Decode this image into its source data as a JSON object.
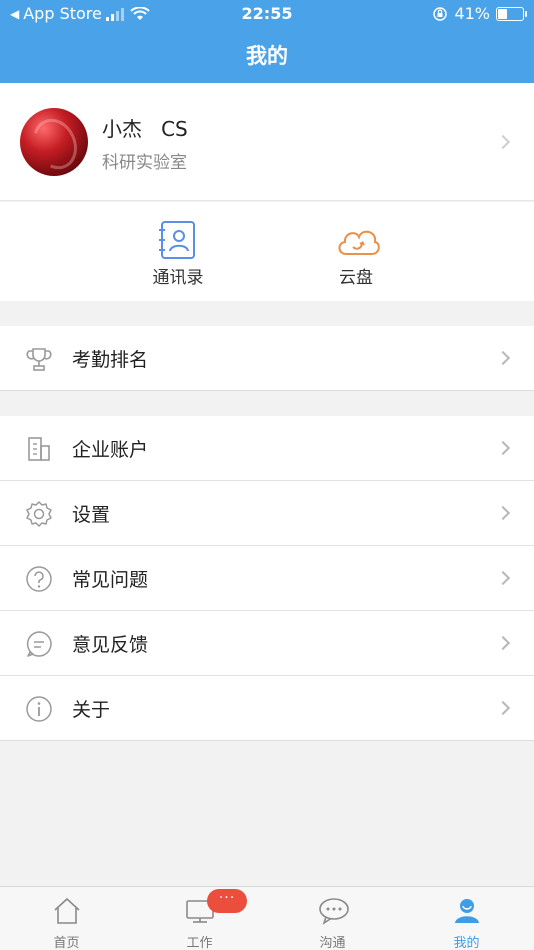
{
  "status_bar": {
    "back_app": "App Store",
    "time": "22:55",
    "battery": "41%",
    "battery_level": 0.41
  },
  "header": {
    "title": "我的"
  },
  "profile": {
    "name": "小杰   CS",
    "org": "科研实验室"
  },
  "quick_actions": [
    {
      "label": "通讯录",
      "icon": "contacts-icon",
      "color": "#5b8ee6"
    },
    {
      "label": "云盘",
      "icon": "cloud-icon",
      "color": "#e8914b"
    }
  ],
  "menu_group1": [
    {
      "label": "考勤排名",
      "icon": "trophy-icon"
    }
  ],
  "menu_group2": [
    {
      "label": "企业账户",
      "icon": "building-icon"
    },
    {
      "label": "设置",
      "icon": "gear-icon"
    },
    {
      "label": "常见问题",
      "icon": "question-icon"
    },
    {
      "label": "意见反馈",
      "icon": "feedback-icon"
    },
    {
      "label": "关于",
      "icon": "info-icon"
    }
  ],
  "tabbar": {
    "tabs": [
      {
        "label": "首页",
        "icon": "home-icon"
      },
      {
        "label": "工作",
        "icon": "monitor-icon"
      },
      {
        "label": "沟通",
        "icon": "chat-icon"
      },
      {
        "label": "我的",
        "icon": "person-icon"
      }
    ],
    "active_index": 3,
    "work_badge": "···"
  },
  "colors": {
    "accent": "#4aa3e8",
    "active_tab": "#3e9de6",
    "badge": "#ec4e3e"
  }
}
